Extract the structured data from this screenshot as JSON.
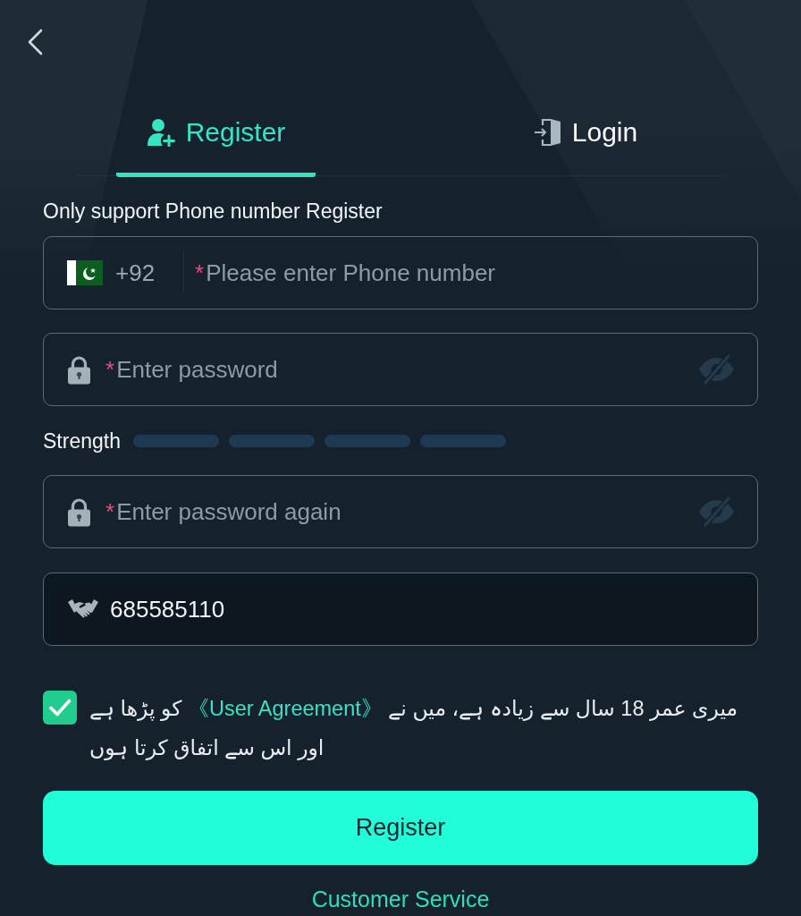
{
  "tabs": [
    {
      "label": "Register",
      "selected": true
    },
    {
      "label": "Login",
      "selected": false
    }
  ],
  "phone_note": "Only support Phone number Register",
  "phone_field": {
    "country_code": "+92",
    "required_mark": "*",
    "placeholder": "Please enter Phone number"
  },
  "password_field": {
    "required_mark": "*",
    "placeholder": "Enter password"
  },
  "strength": {
    "label": "Strength",
    "segments": [
      {
        "filled": false
      },
      {
        "filled": false
      },
      {
        "filled": false
      },
      {
        "filled": false
      }
    ]
  },
  "confirm_password_field": {
    "required_mark": "*",
    "placeholder": "Enter password again"
  },
  "invite_code_field": {
    "value": "685585110",
    "readonly": true
  },
  "agreement": {
    "checked": true,
    "text_before": "میری عمر 18 سال سے زیادہ ہے، میں نے",
    "link": "《User Agreement》",
    "text_after": "کو پڑھا ہے اور اس سے اتفاق کرتا ہوں"
  },
  "register_button": {
    "label": "Register"
  },
  "customer_service": {
    "label": "Customer Service"
  }
}
